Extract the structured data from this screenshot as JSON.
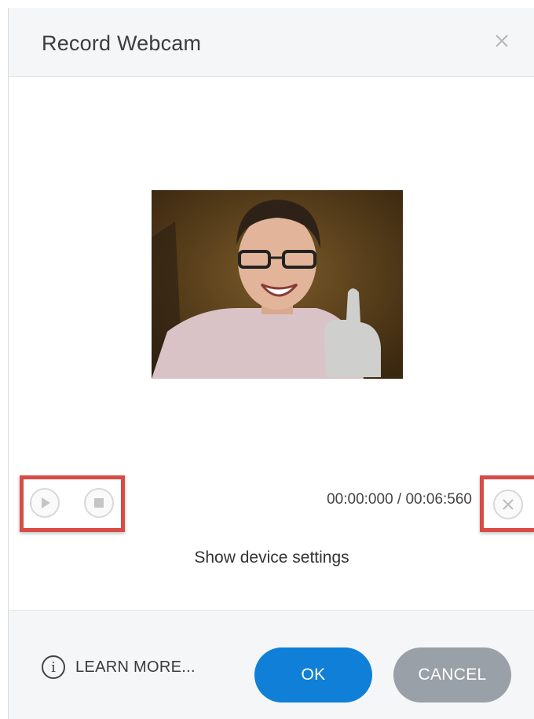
{
  "dialog": {
    "title": "Record Webcam",
    "close_icon": "close-icon"
  },
  "preview": {
    "description_icon": "webcam-preview"
  },
  "playback": {
    "play_icon": "play-icon",
    "stop_icon": "stop-icon",
    "time_display": "00:00:000 / 00:06:560",
    "delete_icon": "close-circle-icon"
  },
  "links": {
    "device_settings": "Show device settings"
  },
  "footer": {
    "learn_more": "LEARN MORE...",
    "info_icon_glyph": "i",
    "ok_label": "OK",
    "cancel_label": "CANCEL"
  },
  "colors": {
    "accent": "#0f7fd8",
    "cancel": "#9aa0a7",
    "highlight": "#d94b45",
    "header_bg": "#f4f6f8"
  }
}
